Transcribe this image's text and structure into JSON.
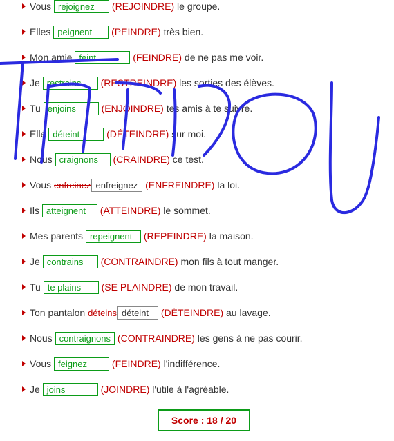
{
  "items": [
    {
      "pre": "Vous ",
      "ans": "rejoignez",
      "verb": "(REJOINDRE)",
      "post": " le groupe.",
      "cutTop": true
    },
    {
      "pre": "Elles ",
      "ans": "peignent",
      "verb": "(PEINDRE)",
      "post": " très bien."
    },
    {
      "pre": "Mon amie ",
      "ans": "feint",
      "verb": "(FEINDRE)",
      "post": " de ne pas me voir."
    },
    {
      "pre": "Je ",
      "ans": "restreins",
      "verb": "(RESTREINDRE)",
      "post": " les sorties des élèves."
    },
    {
      "pre": "Tu ",
      "ans": "enjoins",
      "verb": "(ENJOINDRE)",
      "post": " tes amis à te suivre."
    },
    {
      "pre": "Elle ",
      "ans": "déteint",
      "verb": "(DÉTEINDRE)",
      "post": " sur moi."
    },
    {
      "pre": "Nous ",
      "ans": "craignons",
      "verb": "(CRAINDRE)",
      "post": " ce test."
    },
    {
      "pre": "Vous ",
      "wrong": "enfreinez",
      "corr": "enfreignez",
      "verb": "(ENFREINDRE)",
      "post": " la loi."
    },
    {
      "pre": "Ils ",
      "ans": "atteignent",
      "verb": "(ATTEINDRE)",
      "post": " le sommet."
    },
    {
      "pre": "Mes parents ",
      "ans": "repeignent",
      "verb": "(REPEINDRE)",
      "post": " la maison."
    },
    {
      "pre": "Je ",
      "ans": "contrains",
      "verb": "(CONTRAINDRE)",
      "post": " mon fils à tout manger."
    },
    {
      "pre": "Tu ",
      "ans": "te plains",
      "verb": "(SE PLAINDRE)",
      "post": " de mon travail."
    },
    {
      "pre": "Ton pantalon ",
      "wrong": "déteins",
      "corr": "déteint",
      "verb": "(DÉTEINDRE)",
      "post": " au lavage."
    },
    {
      "pre": "Nous ",
      "ans": "contraignons",
      "verb": "(CONTRAINDRE)",
      "post": " les gens à ne pas courir."
    },
    {
      "pre": "Vous ",
      "ans": "feignez",
      "verb": "(FEINDRE)",
      "post": " l'indifférence."
    },
    {
      "pre": "Je ",
      "ans": "joins",
      "verb": "(JOINDRE)",
      "post": " l'utile à l'agréable."
    }
  ],
  "score": {
    "label": "Score : 18 / 20"
  },
  "ink_color": "#2a2ae0"
}
